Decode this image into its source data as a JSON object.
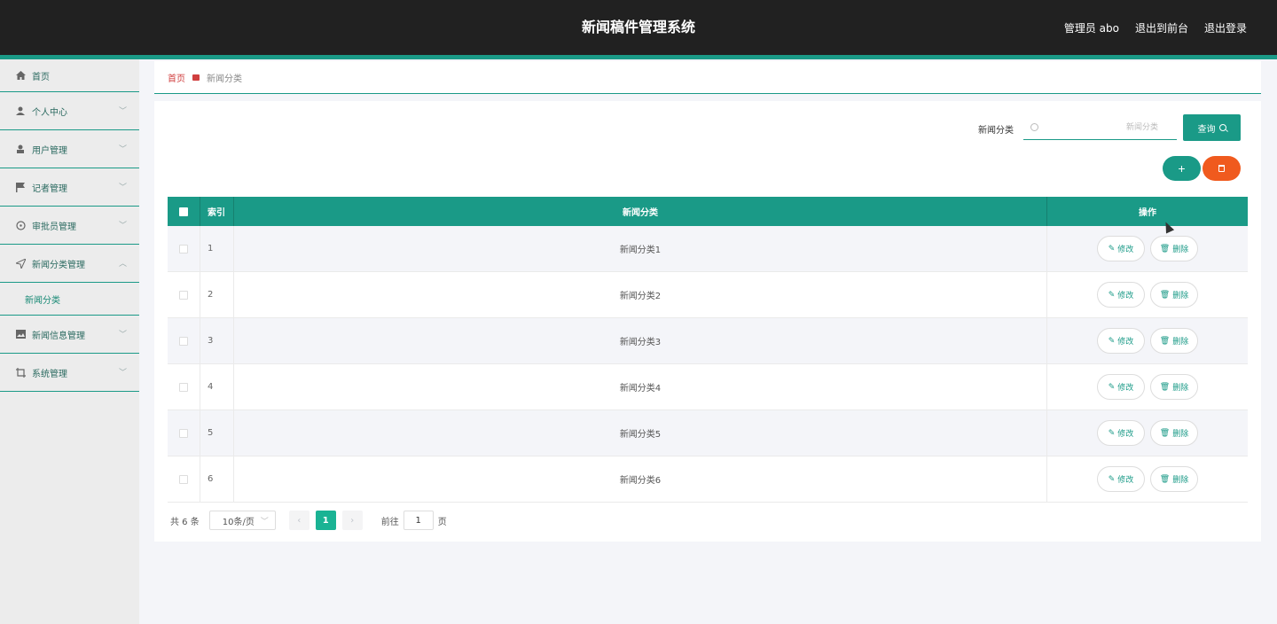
{
  "header": {
    "title": "新闻稿件管理系统",
    "user": "管理员 abo",
    "to_front": "退出到前台",
    "logout": "退出登录"
  },
  "sidebar": {
    "items": [
      {
        "label": "首页",
        "icon": "home-icon"
      },
      {
        "label": "个人中心",
        "icon": "person-icon"
      },
      {
        "label": "用户管理",
        "icon": "user-icon"
      },
      {
        "label": "记者管理",
        "icon": "flag-icon"
      },
      {
        "label": "审批员管理",
        "icon": "compass-icon"
      },
      {
        "label": "新闻分类管理",
        "icon": "send-icon",
        "expanded": true,
        "children": [
          {
            "label": "新闻分类"
          }
        ]
      },
      {
        "label": "新闻信息管理",
        "icon": "picture-icon"
      },
      {
        "label": "系统管理",
        "icon": "crop-icon"
      }
    ]
  },
  "breadcrumb": {
    "home": "首页",
    "current": "新闻分类"
  },
  "search": {
    "label": "新闻分类",
    "placeholder": "新闻分类",
    "button": "查询"
  },
  "actions": {
    "add": "+"
  },
  "table": {
    "columns": {
      "index": "索引",
      "name": "新闻分类",
      "ops": "操作"
    },
    "rows": [
      {
        "index": "1",
        "name": "新闻分类1"
      },
      {
        "index": "2",
        "name": "新闻分类2"
      },
      {
        "index": "3",
        "name": "新闻分类3"
      },
      {
        "index": "4",
        "name": "新闻分类4"
      },
      {
        "index": "5",
        "name": "新闻分类5"
      },
      {
        "index": "6",
        "name": "新闻分类6"
      }
    ],
    "edit_label": "修改",
    "delete_label": "删除"
  },
  "pagination": {
    "total": "共 6 条",
    "page_size": "10条/页",
    "current": "1",
    "goto_label": "前往",
    "goto_value": "1",
    "goto_suffix": "页"
  },
  "colors": {
    "accent": "#1a9a87",
    "danger": "#f05a1e",
    "topbar": "#212121"
  }
}
